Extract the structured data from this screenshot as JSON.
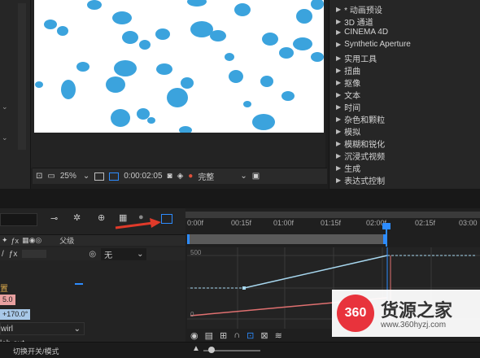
{
  "effects_panel": {
    "items": [
      {
        "label": "* 动画预设"
      },
      {
        "label": "3D 通道"
      },
      {
        "label": "CINEMA 4D"
      },
      {
        "label": "Synthetic Aperture"
      },
      {
        "label": "实用工具"
      },
      {
        "label": "扭曲"
      },
      {
        "label": "抠像"
      },
      {
        "label": "文本"
      },
      {
        "label": "时间"
      },
      {
        "label": "杂色和颗粒"
      },
      {
        "label": "模拟"
      },
      {
        "label": "模糊和锐化"
      },
      {
        "label": "沉浸式视频"
      },
      {
        "label": "生成"
      },
      {
        "label": "表达式控制"
      }
    ]
  },
  "viewer": {
    "zoom": "25%",
    "timecode": "0:00:02:05",
    "resolution": "完整"
  },
  "timeline": {
    "ruler": [
      "0:00f",
      "00:15f",
      "01:00f",
      "01:15f",
      "02:00f",
      "02:15f",
      "03:00"
    ],
    "parent_header": "父级",
    "parent_value": "无",
    "graph_value_label": "500",
    "graph_zero_label": "0",
    "bottom_label": "切换开关/模式"
  },
  "layer_panel": {
    "prop_label": "置",
    "value_red": "5.0",
    "value_blue": "+170.0°",
    "effect_name": "wirl",
    "effect_name2": "lob out"
  },
  "watermark": {
    "number": "360",
    "title": "货源之家",
    "url": "www.360hyzj.com"
  },
  "colors": {
    "blob": "#3ba3dd",
    "accent_blue": "#2d8cff",
    "playhead": "#2d8cff",
    "curve_blue": "#a8d8f0",
    "curve_red": "#e07070",
    "arrow_red": "#e03a2a",
    "watermark_red": "#e8333c"
  }
}
